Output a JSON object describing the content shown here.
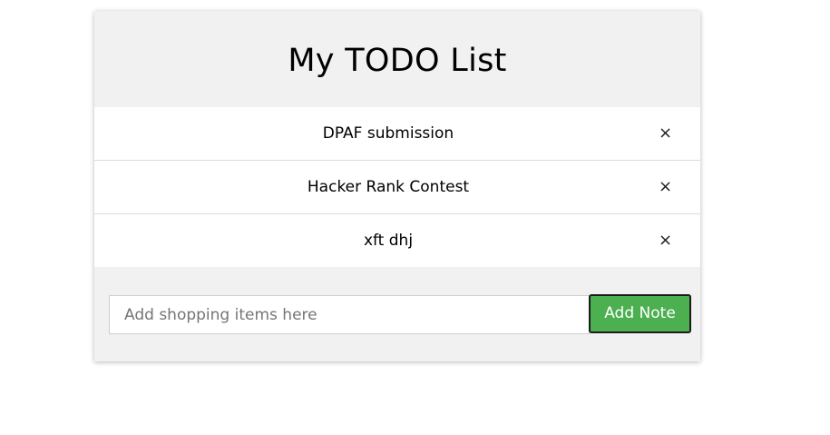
{
  "header": {
    "title": "My TODO List"
  },
  "todos": [
    {
      "text": "DPAF submission",
      "close_glyph": "×"
    },
    {
      "text": "Hacker Rank Contest",
      "close_glyph": "×"
    },
    {
      "text": "xft dhj",
      "close_glyph": "×"
    }
  ],
  "form": {
    "input_value": "",
    "input_placeholder": "Add shopping items here",
    "add_label": "Add Note"
  },
  "colors": {
    "panel": "#f1f1f1",
    "button": "#4caf50",
    "button_border": "#1b1b1b"
  },
  "icons": {
    "close": "close-icon"
  }
}
